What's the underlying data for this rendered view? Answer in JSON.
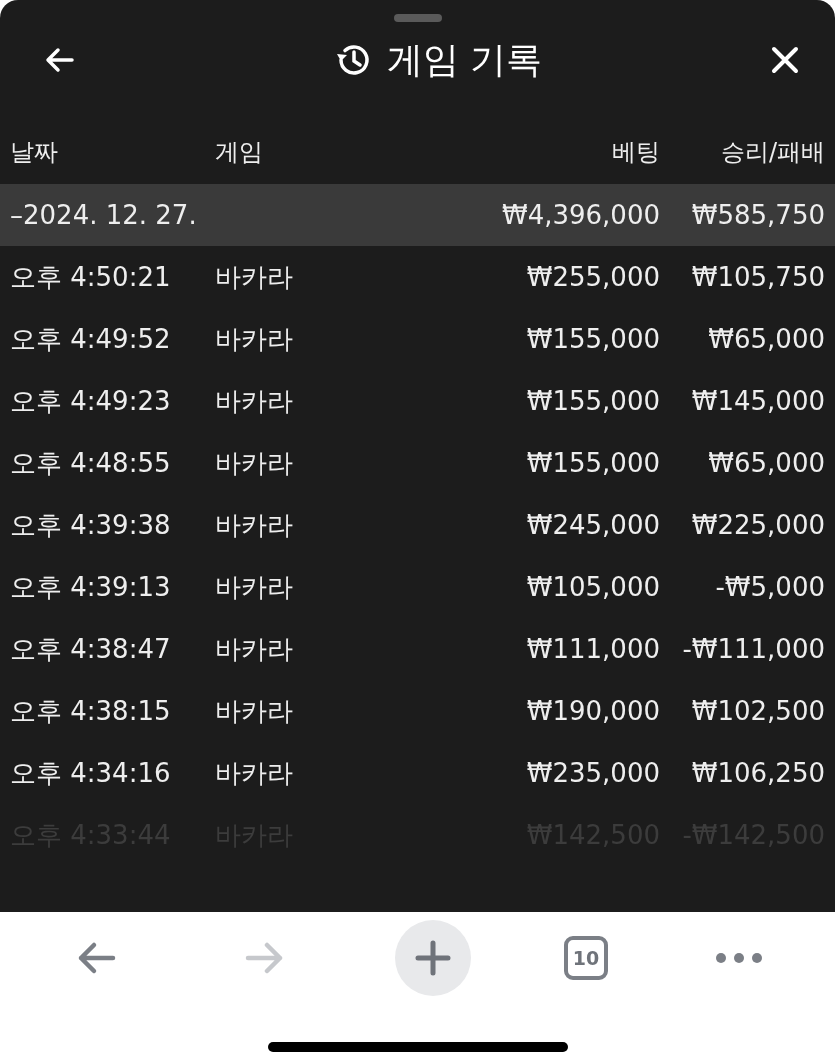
{
  "header": {
    "title": "게임 기록"
  },
  "columns": [
    "날짜",
    "게임",
    "베팅",
    "승리/패배"
  ],
  "group": {
    "date": "–2024. 12. 27.",
    "bet": "₩4,396,000",
    "result": "₩585,750"
  },
  "rows": [
    {
      "time": "오후 4:50:21",
      "game": "바카라",
      "bet": "₩255,000",
      "result": "₩105,750",
      "faded": false
    },
    {
      "time": "오후 4:49:52",
      "game": "바카라",
      "bet": "₩155,000",
      "result": "₩65,000",
      "faded": false
    },
    {
      "time": "오후 4:49:23",
      "game": "바카라",
      "bet": "₩155,000",
      "result": "₩145,000",
      "faded": false
    },
    {
      "time": "오후 4:48:55",
      "game": "바카라",
      "bet": "₩155,000",
      "result": "₩65,000",
      "faded": false
    },
    {
      "time": "오후 4:39:38",
      "game": "바카라",
      "bet": "₩245,000",
      "result": "₩225,000",
      "faded": false
    },
    {
      "time": "오후 4:39:13",
      "game": "바카라",
      "bet": "₩105,000",
      "result": "-₩5,000",
      "faded": false
    },
    {
      "time": "오후 4:38:47",
      "game": "바카라",
      "bet": "₩111,000",
      "result": "-₩111,000",
      "faded": false
    },
    {
      "time": "오후 4:38:15",
      "game": "바카라",
      "bet": "₩190,000",
      "result": "₩102,500",
      "faded": false
    },
    {
      "time": "오후 4:34:16",
      "game": "바카라",
      "bet": "₩235,000",
      "result": "₩106,250",
      "faded": false
    },
    {
      "time": "오후 4:33:44",
      "game": "바카라",
      "bet": "₩142,500",
      "result": "-₩142,500",
      "faded": true
    }
  ],
  "toolbar": {
    "forward_disabled": true,
    "tab_count": "10"
  }
}
